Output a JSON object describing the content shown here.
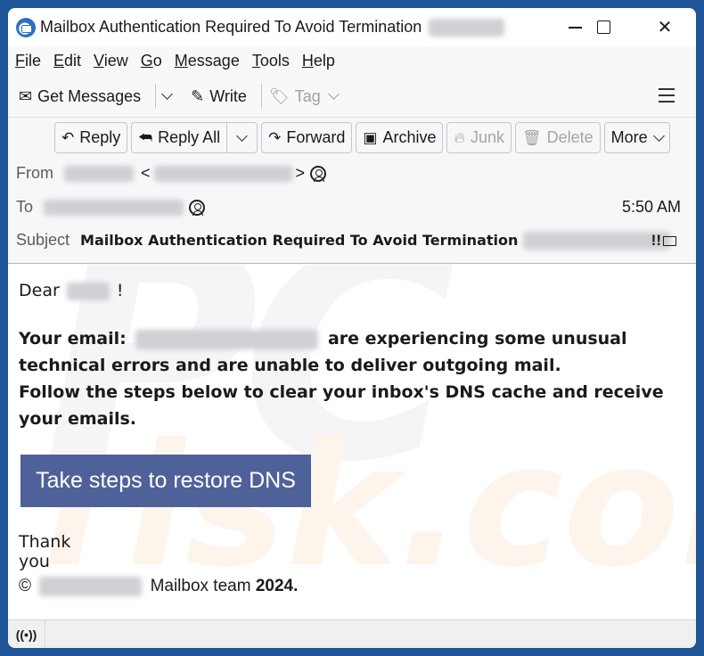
{
  "window": {
    "title": "Mailbox Authentication Required To Avoid Termination",
    "title_redacted": true
  },
  "menubar": {
    "items": [
      {
        "label": "File",
        "accel": "F",
        "rest": "ile"
      },
      {
        "label": "Edit",
        "accel": "E",
        "rest": "dit"
      },
      {
        "label": "View",
        "accel": "V",
        "rest": "iew"
      },
      {
        "label": "Go",
        "accel": "G",
        "rest": "o"
      },
      {
        "label": "Message",
        "accel": "M",
        "rest": "essage"
      },
      {
        "label": "Tools",
        "accel": "T",
        "rest": "ools"
      },
      {
        "label": "Help",
        "accel": "H",
        "rest": "elp"
      }
    ]
  },
  "toolbar": {
    "get_messages": "Get Messages",
    "write": "Write",
    "tag": "Tag"
  },
  "actions": {
    "reply": "Reply",
    "reply_all": "Reply All",
    "forward": "Forward",
    "archive": "Archive",
    "junk": "Junk",
    "delete": "Delete",
    "more": "More"
  },
  "header": {
    "from_label": "From",
    "to_label": "To",
    "subject_label": "Subject",
    "time": "5:50 AM",
    "subject": "Mailbox Authentication Required To Avoid Termination",
    "subject_flags": "!!"
  },
  "message": {
    "greeting": "Dear",
    "greeting_end": "!",
    "email_prefix": "Your email:",
    "line1_rest": "are experiencing some unusual technical errors and are unable to deliver outgoing mail.",
    "line2": "Follow the steps below to clear your inbox's DNS cache and receive your emails.",
    "cta_label": "Take steps to restore DNS",
    "thanks": "Thank you",
    "copyright_symbol": "©",
    "signature_team": "Mailbox team",
    "signature_year": "2024."
  },
  "watermark": {
    "top": "PC",
    "bottom": "risk.com"
  },
  "colors": {
    "desktop": "#1f5596",
    "cta": "#4f6199"
  }
}
